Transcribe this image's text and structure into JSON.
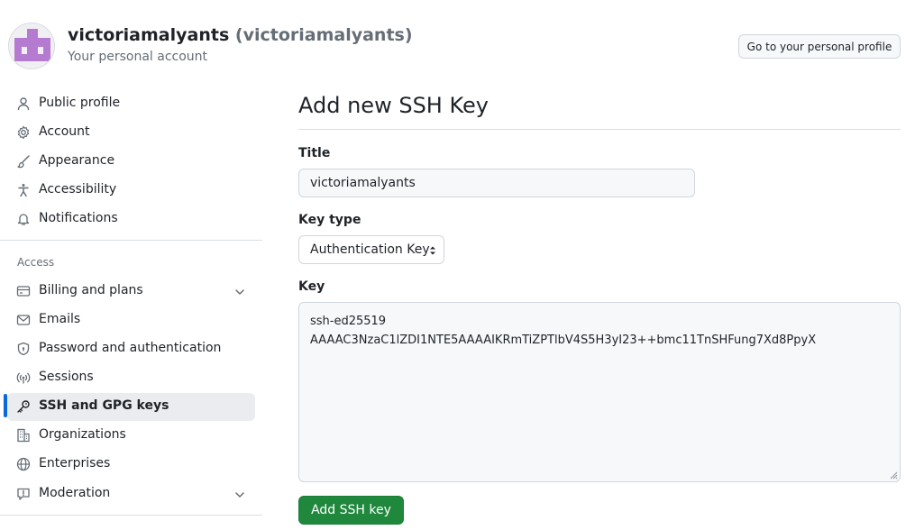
{
  "header": {
    "display_name": "victoriamalyants",
    "login": "(victoriamalyants)",
    "subtitle": "Your personal account",
    "profile_button": "Go to your personal profile"
  },
  "sidebar": {
    "section_access": "Access",
    "items": [
      {
        "label": "Public profile",
        "icon": "person-icon"
      },
      {
        "label": "Account",
        "icon": "gear-icon"
      },
      {
        "label": "Appearance",
        "icon": "paintbrush-icon"
      },
      {
        "label": "Accessibility",
        "icon": "accessibility-icon"
      },
      {
        "label": "Notifications",
        "icon": "bell-icon"
      },
      {
        "label": "Billing and plans",
        "icon": "credit-card-icon"
      },
      {
        "label": "Emails",
        "icon": "mail-icon"
      },
      {
        "label": "Password and authentication",
        "icon": "shield-lock-icon"
      },
      {
        "label": "Sessions",
        "icon": "broadcast-icon"
      },
      {
        "label": "SSH and GPG keys",
        "icon": "key-icon"
      },
      {
        "label": "Organizations",
        "icon": "organization-icon"
      },
      {
        "label": "Enterprises",
        "icon": "globe-icon"
      },
      {
        "label": "Moderation",
        "icon": "report-icon"
      }
    ]
  },
  "main": {
    "heading": "Add new SSH Key",
    "title_label": "Title",
    "title_value": "victoriamalyants",
    "key_type_label": "Key type",
    "key_type_value": "Authentication Key",
    "key_label": "Key",
    "key_line1": "ssh-ed25519",
    "key_line2": "AAAAC3NzaC1lZDI1NTE5AAAAIKRmTiZPTlbV4S5H3yI23++bmc11TnSHFung7Xd8PpyX",
    "submit_label": "Add SSH key"
  },
  "colors": {
    "accent": "#0969da",
    "primary_button": "#1f883d",
    "avatar": "#b57bd0"
  }
}
